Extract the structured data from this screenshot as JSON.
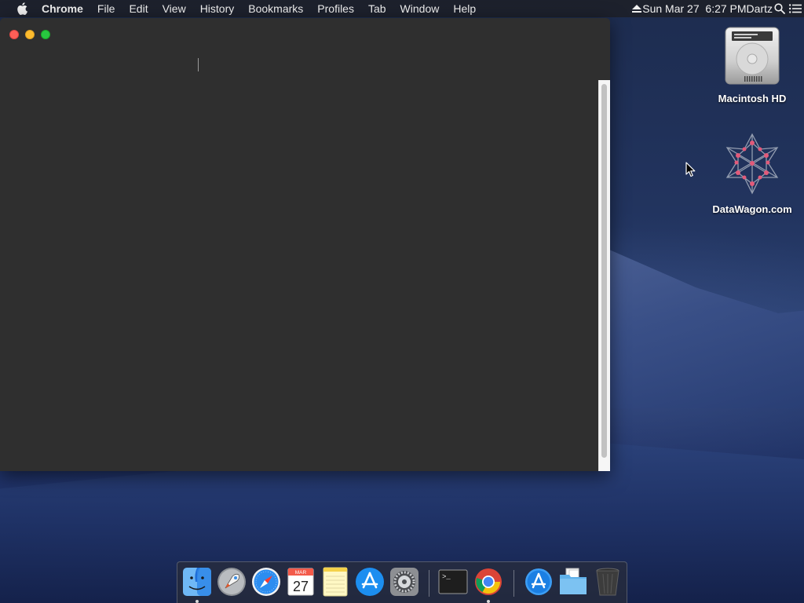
{
  "menubar": {
    "apple_icon": "apple-icon",
    "app_name": "Chrome",
    "items": [
      "File",
      "Edit",
      "View",
      "History",
      "Bookmarks",
      "Profiles",
      "Tab",
      "Window",
      "Help"
    ],
    "clock": "Sun Mar 27  6:27 PM",
    "user": "Dartz",
    "right_icons": [
      "eject-icon",
      "spotlight-search-icon",
      "notification-center-icon"
    ]
  },
  "window": {
    "background": "#2f2f2f",
    "traffic_lights": [
      "close",
      "minimize",
      "zoom"
    ]
  },
  "desktop": {
    "icons": [
      {
        "label": "Macintosh HD",
        "icon": "hard-drive-icon"
      },
      {
        "label": "DataWagon.com",
        "icon": "network-star-icon"
      }
    ]
  },
  "dock": {
    "items": [
      {
        "name": "Finder",
        "icon": "finder-icon",
        "running": true
      },
      {
        "name": "Launchpad",
        "icon": "launchpad-icon",
        "running": false
      },
      {
        "name": "Safari",
        "icon": "safari-icon",
        "running": false
      },
      {
        "name": "Calendar",
        "icon": "calendar-icon",
        "running": false,
        "month": "MAR",
        "day": "27"
      },
      {
        "name": "Notes",
        "icon": "notes-icon",
        "running": false
      },
      {
        "name": "App Store",
        "icon": "app-store-icon",
        "running": false
      },
      {
        "name": "System Preferences",
        "icon": "system-preferences-icon",
        "running": false
      },
      {
        "name": "Terminal",
        "icon": "terminal-icon",
        "running": false,
        "prompt": ">_"
      },
      {
        "name": "Google Chrome",
        "icon": "chrome-icon",
        "running": true
      },
      {
        "name": "Applications",
        "icon": "applications-folder-icon",
        "running": false
      },
      {
        "name": "Downloads",
        "icon": "downloads-folder-icon",
        "running": false
      },
      {
        "name": "Trash",
        "icon": "trash-icon",
        "running": false
      }
    ]
  }
}
